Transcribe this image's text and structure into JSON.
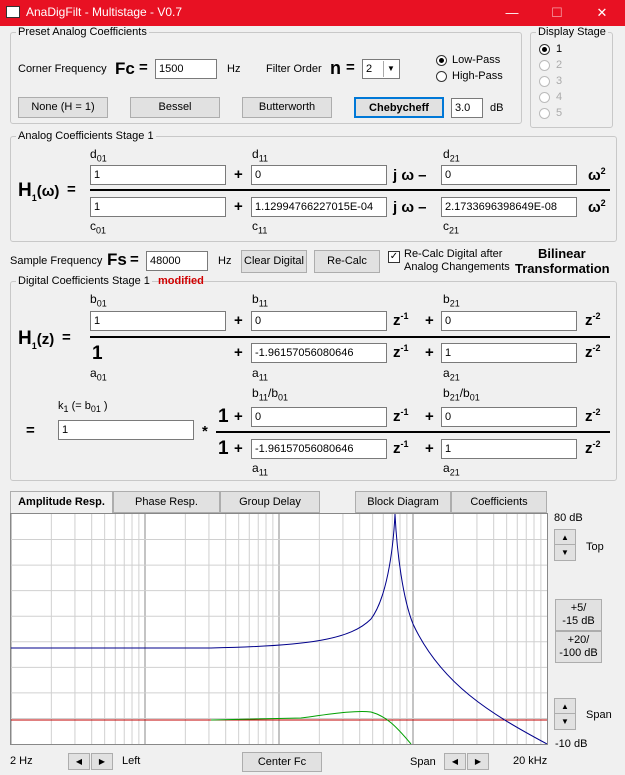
{
  "window": {
    "title": "AnaDigFilt - Multistage - V0.7",
    "minimize": "—",
    "maximize": "☐",
    "close": "✕"
  },
  "preset": {
    "group_label": "Preset Analog Coefficients",
    "corner_label": "Corner Frequency",
    "fc_symbol": "Fc",
    "eq": "=",
    "fc_value": "1500",
    "hz": "Hz",
    "order_label": "Filter Order",
    "n_symbol": "n",
    "order_value": "2",
    "lowpass": "Low-Pass",
    "highpass": "High-Pass",
    "btn_none": "None (H = 1)",
    "btn_bessel": "Bessel",
    "btn_butterworth": "Butterworth",
    "btn_chebycheff": "Chebycheff",
    "ripple_value": "3.0",
    "db": "dB"
  },
  "display_stage": {
    "label": "Display Stage",
    "stages": [
      "1",
      "2",
      "3",
      "4",
      "5"
    ],
    "selected": "1"
  },
  "analog": {
    "group_label": "Analog Coefficients Stage 1",
    "h_label": "H",
    "h_sub": "1",
    "h_arg": "(ω)",
    "eq": "=",
    "d01": "d",
    "d01s": "01",
    "d11": "d",
    "d11s": "11",
    "d21": "d",
    "d21s": "21",
    "c01": "c",
    "c01s": "01",
    "c11": "c",
    "c11s": "11",
    "c21": "c",
    "c21s": "21",
    "d0_val": "1",
    "d1_val": "0",
    "d2_val": "0",
    "c0_val": "1",
    "c1_val": "1.12994766227015E-04",
    "c2_val": "2.1733696398649E-08",
    "plus": "+",
    "jw_minus": "j ω –",
    "w2": "ω",
    "w2_sup": "2"
  },
  "sample": {
    "label": "Sample Frequency",
    "fs_symbol": "Fs",
    "eq": "=",
    "fs_value": "48000",
    "hz": "Hz",
    "btn_clear": "Clear Digital",
    "btn_recalc": "Re-Calc",
    "chk_label_1": "Re-Calc Digital after",
    "chk_label_2": "Analog Changements",
    "bilinear_1": "Bilinear",
    "bilinear_2": "Transformation"
  },
  "digital": {
    "group_label": "Digital Coefficients Stage 1",
    "modified": "modified",
    "h_label": "H",
    "h_sub": "1",
    "h_arg": "(z)",
    "eq": "=",
    "b01": "b",
    "b01s": "01",
    "b11": "b",
    "b11s": "11",
    "b21": "b",
    "b21s": "21",
    "a01": "a",
    "a01s": "01",
    "a11": "a",
    "a11s": "11",
    "a21": "a",
    "a21s": "21",
    "b0_val": "1",
    "b1_val": "0",
    "b2_val": "0",
    "a0_text": "1",
    "a1_val": "-1.96157056080646",
    "a2_val": "1",
    "plus": "+",
    "z": "z",
    "zm1": "-1",
    "zm2": "-2",
    "k1_label": "k",
    "k1_sub": "1",
    "k1_rest": "(= b",
    "k1_rest_sub": "01",
    "k1_close": ")",
    "k1_value": "1",
    "star": "*",
    "one": "1",
    "bn11": "b",
    "bn11s": "11",
    "bn11d": "/b",
    "bn11ds": "01",
    "bn21": "b",
    "bn21s": "21",
    "bn21d": "/b",
    "bn21ds": "01",
    "n_b1_val": "0",
    "n_b2_val": "0",
    "n_a1_val": "-1.96157056080646",
    "n_a2_val": "1",
    "n_a11": "a",
    "n_a11s": "11",
    "n_a21": "a",
    "n_a21s": "21"
  },
  "tabs": [
    "Amplitude Resp.",
    "Phase Resp.",
    "Group Delay",
    "Block Diagram",
    "Coefficients"
  ],
  "active_tab": "Amplitude Resp.",
  "plot_controls": {
    "top_db": "80 dB",
    "top_label": "Top",
    "btn_5_15_a": "+5/",
    "btn_5_15_b": "-15 dB",
    "btn_20_100_a": "+20/",
    "btn_20_100_b": "-100 dB",
    "span_label": "Span",
    "bottom_db": "-10 dB"
  },
  "bottom": {
    "left_freq": "2 Hz",
    "left_label": "Left",
    "center_btn": "Center Fc",
    "span_label": "Span",
    "right_freq": "20 kHz"
  },
  "colors": {
    "titlebar": "#e81123",
    "curve_blue": "#00008b",
    "curve_green": "#00a000",
    "curve_red": "#c00000"
  }
}
